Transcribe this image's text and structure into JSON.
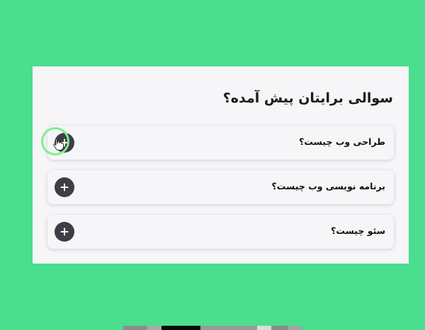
{
  "faq": {
    "title": "سوالی برایتان پیش آمده؟",
    "items": [
      {
        "question": "طراحی وب چیست؟"
      },
      {
        "question": "برنامه نویسی وب چیست؟"
      },
      {
        "question": "سئو چیست؟"
      }
    ]
  },
  "icons": {
    "toggle": "plus-icon",
    "cursor": "hand-pointer-icon"
  },
  "colors": {
    "background": "#4ade8f",
    "panel": "#f6f5f8",
    "toggle_button": "#3f3d46",
    "click_highlight": "#7cf08f"
  }
}
